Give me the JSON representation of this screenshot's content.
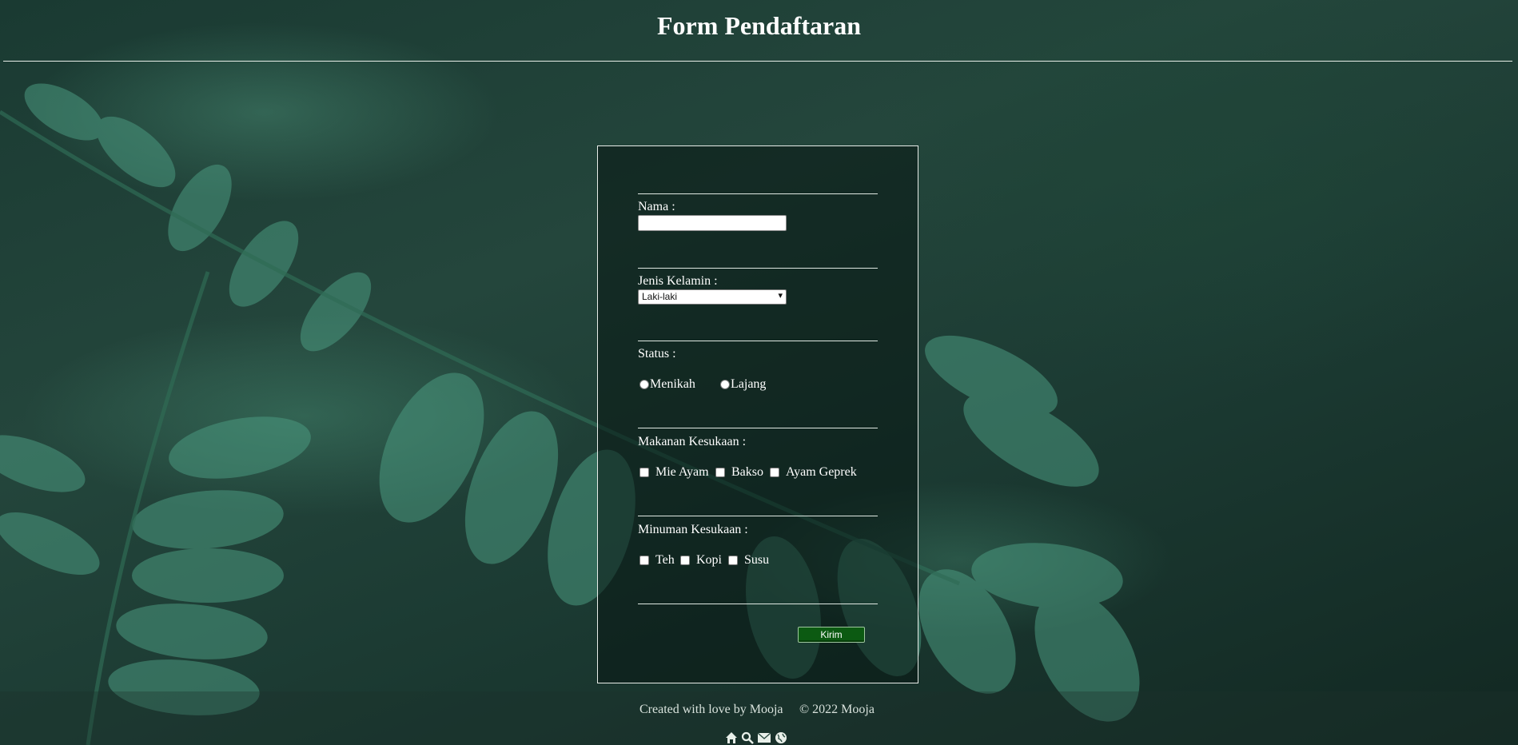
{
  "page": {
    "title": "Form Pendaftaran"
  },
  "form": {
    "nama": {
      "label": "Nama :",
      "value": ""
    },
    "jenis_kelamin": {
      "label": "Jenis Kelamin :",
      "selected": "Laki-laki"
    },
    "status": {
      "label": "Status :",
      "options": [
        "Menikah",
        "Lajang"
      ]
    },
    "makanan": {
      "label": "Makanan Kesukaan :",
      "options": [
        "Mie Ayam",
        "Bakso",
        "Ayam Geprek"
      ]
    },
    "minuman": {
      "label": "Minuman Kesukaan :",
      "options": [
        "Teh",
        "Kopi",
        "Susu"
      ]
    },
    "submit_label": "Kirim"
  },
  "footer": {
    "credit": "Created with love by Mooja",
    "copyright": "© 2022 Mooja",
    "icons": [
      "home-icon",
      "search-icon",
      "envelope-icon",
      "globe-icon"
    ]
  },
  "colors": {
    "submit_bg": "#0c5a12",
    "rule": "#e8efe9",
    "background": "#1e4038"
  }
}
